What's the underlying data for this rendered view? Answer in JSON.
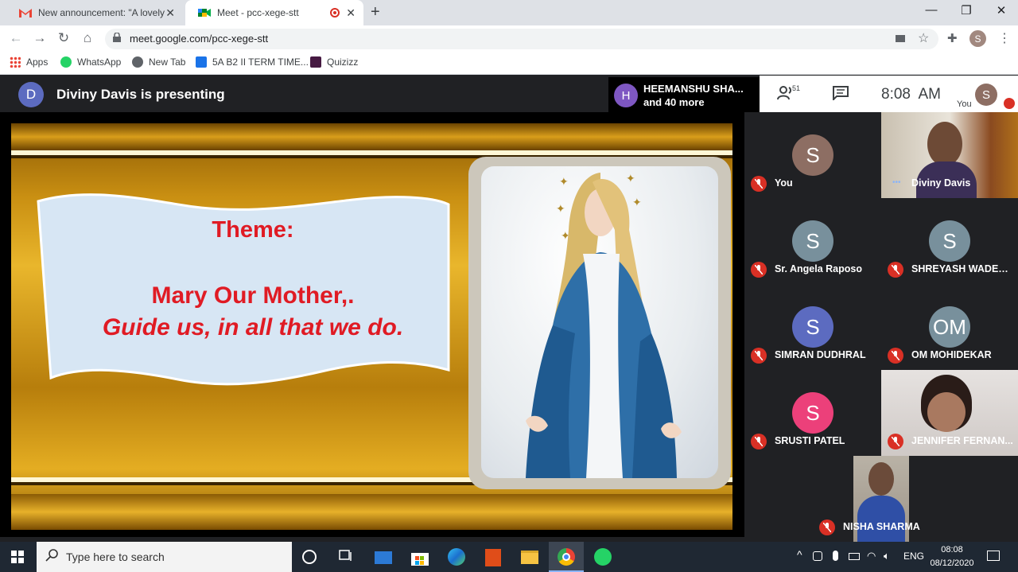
{
  "browser": {
    "tabs": [
      {
        "title": "New announcement: \"A lovely m",
        "icon": "gmail-icon",
        "active": false
      },
      {
        "title": "Meet - pcc-xege-stt",
        "icon": "meet-icon",
        "active": true
      }
    ],
    "url": "meet.google.com/pcc-xege-stt",
    "profile_initial": "S",
    "bookmarks": [
      "Apps",
      "WhatsApp",
      "New Tab",
      "5A B2 II TERM TIME...",
      "Quizizz"
    ]
  },
  "meet": {
    "presenter_initial": "D",
    "presenting_text": "Diviny Davis is presenting",
    "chip": {
      "initial": "H",
      "line1": "HEEMANSHU SHA...",
      "line2": "and 40 more"
    },
    "participant_count": "51",
    "time": "8:08  AM",
    "self_label": "You",
    "self_initial": "S",
    "slide": {
      "theme_title": "Theme:",
      "line1": "Mary Our Mother,.",
      "line2": "Guide us, in all that we do."
    },
    "participants": [
      {
        "name": "You",
        "initial": "S",
        "color": "#8d6e63",
        "video": false
      },
      {
        "name": "Diviny Davis",
        "initial": "",
        "color": "",
        "video": true
      },
      {
        "name": "Sr. Angela Raposo",
        "initial": "S",
        "color": "#78909c",
        "video": false
      },
      {
        "name": "SHREYASH WADEK...",
        "initial": "S",
        "color": "#78909c",
        "video": false
      },
      {
        "name": "SIMRAN DUDHRAL",
        "initial": "S",
        "color": "#5c6bc0",
        "video": false
      },
      {
        "name": "OM MOHIDEKAR",
        "initial": "OM",
        "color": "#78909c",
        "video": false
      },
      {
        "name": "SRUSTI PATEL",
        "initial": "S",
        "color": "#ec407a",
        "video": false
      },
      {
        "name": "JENNIFER FERNAN...",
        "initial": "",
        "color": "",
        "video": true
      },
      {
        "name": "NISHA SHARMA",
        "initial": "",
        "color": "",
        "video": true
      }
    ]
  },
  "taskbar": {
    "search_placeholder": "Type here to search",
    "language": "ENG",
    "time": "08:08",
    "date": "08/12/2020"
  }
}
